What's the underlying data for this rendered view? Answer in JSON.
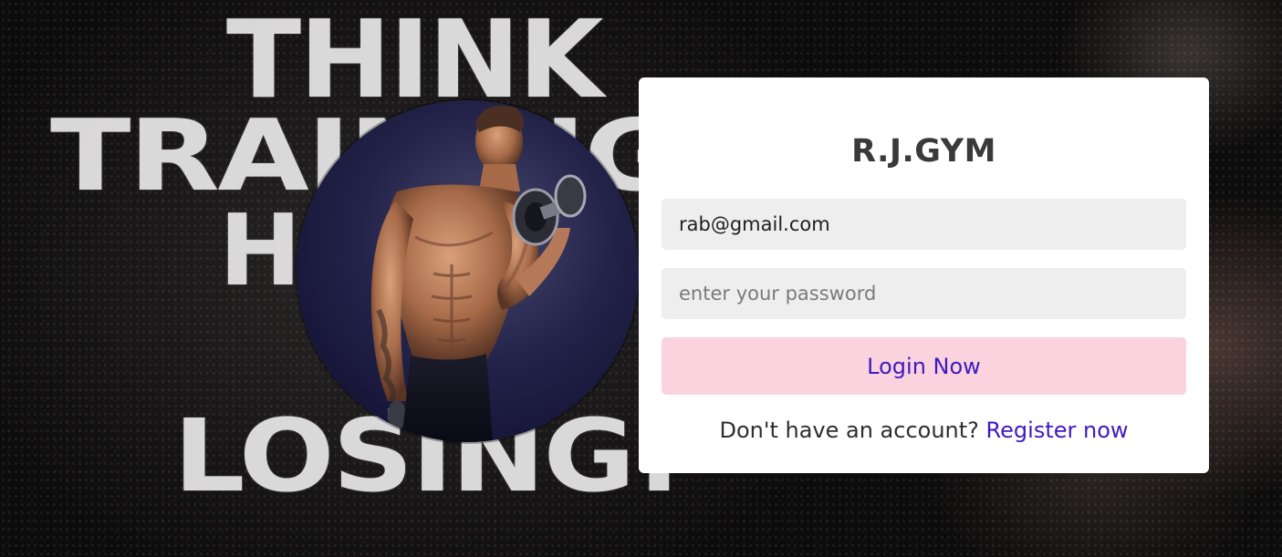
{
  "background": {
    "poster_lines": [
      "THINK",
      "TRAINING",
      "HURTS",
      "LOSING!"
    ]
  },
  "login": {
    "brand": "R.J.GYM",
    "email_value": "rab@gmail.com",
    "password_placeholder": "enter your password",
    "login_label": "Login Now",
    "register_prompt": "Don't have an account?",
    "register_link": "Register now"
  },
  "colors": {
    "button_bg": "#fad3de",
    "accent_text": "#3f1ac0",
    "field_bg": "#eeeeee"
  },
  "icons": {
    "avatar": "bodybuilder-photo"
  }
}
